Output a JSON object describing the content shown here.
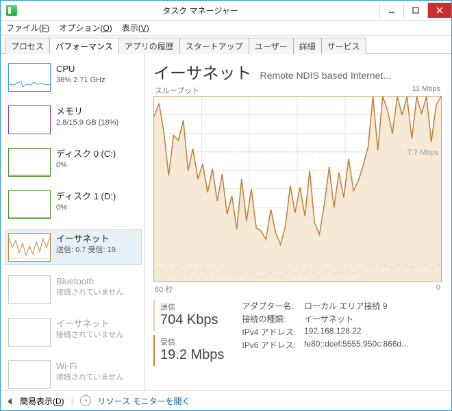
{
  "window": {
    "title": "タスク マネージャー"
  },
  "menu": {
    "file": "ファイル(F)",
    "options": "オプション(O)",
    "view": "表示(V)"
  },
  "tabs": [
    {
      "label": "プロセス"
    },
    {
      "label": "パフォーマンス"
    },
    {
      "label": "アプリの履歴"
    },
    {
      "label": "スタートアップ"
    },
    {
      "label": "ユーザー"
    },
    {
      "label": "詳細"
    },
    {
      "label": "サービス"
    }
  ],
  "sidebar": {
    "items": [
      {
        "title": "CPU",
        "sub": "38% 2.71 GHz",
        "color": "#3b9dd3"
      },
      {
        "title": "メモリ",
        "sub": "2.8/15.9 GB (18%)",
        "color": "#8a2fa2"
      },
      {
        "title": "ディスク 0 (C:)",
        "sub": "0%",
        "color": "#4a8b2a"
      },
      {
        "title": "ディスク 1 (D:)",
        "sub": "0%",
        "color": "#4a8b2a"
      },
      {
        "title": "イーサネット",
        "sub": "送信: 0.7 受信: 19.",
        "color": "#c08238"
      },
      {
        "title": "Bluetooth",
        "sub": "接続されていません",
        "color": "#c7c7c7"
      },
      {
        "title": "イーサネット",
        "sub": "接続されていません",
        "color": "#c7c7c7"
      },
      {
        "title": "Wi-Fi",
        "sub": "接続されていません",
        "color": "#c7c7c7"
      }
    ]
  },
  "panel": {
    "title": "イーサネット",
    "subtitle": "Remote NDIS based Internet...",
    "chart": {
      "throughput_label": "スループット",
      "max_label": "11 Mbps",
      "ref_label": "7.7 Mbps",
      "x_left": "60 秒",
      "x_right": "0"
    },
    "send": {
      "label": "送信",
      "value": "704 Kbps",
      "color": "#e9cfa6"
    },
    "recv": {
      "label": "受信",
      "value": "19.2 Mbps",
      "color": "#c08238"
    },
    "details": {
      "adapter_name_k": "アダプター名:",
      "adapter_name_v": "ローカル エリア接続 9",
      "conn_type_k": "接続の種類:",
      "conn_type_v": "イーサネット",
      "ipv4_k": "IPv4 アドレス:",
      "ipv4_v": "192.168.128.22",
      "ipv6_k": "IPv6 アドレス:",
      "ipv6_v": "fe80::dcef:5555:950c:866d..."
    }
  },
  "statusbar": {
    "simple": "簡易表示(D)",
    "resmon": "リソース モニターを開く"
  },
  "chart_data": {
    "type": "line",
    "title": "イーサネット スループット",
    "xlabel": "秒",
    "ylabel": "Mbps",
    "x_range": [
      60,
      0
    ],
    "ylim": [
      0,
      11
    ],
    "reference_lines": [
      7.7
    ],
    "series": [
      {
        "name": "受信",
        "color": "#c08238",
        "unit": "Mbps",
        "values": [
          9.8,
          10.6,
          8.9,
          6.3,
          8.7,
          8.4,
          9.6,
          6.6,
          7.9,
          6.1,
          7.0,
          5.3,
          6.7,
          4.8,
          6.4,
          4.0,
          5.1,
          3.1,
          6.1,
          3.6,
          5.5,
          3.2,
          3.0,
          2.5,
          4.3,
          2.9,
          2.2,
          3.3,
          5.7,
          4.1,
          5.6,
          3.9,
          6.6,
          3.5,
          2.8,
          4.6,
          6.8,
          4.4,
          6.5,
          5.0,
          7.3,
          5.4,
          6.0,
          6.9,
          8.0,
          11.0,
          7.8,
          11.0,
          10.2,
          8.8,
          11.0,
          9.9,
          11.0,
          8.5,
          11.0,
          10.0,
          11.0,
          8.3,
          10.5,
          11.0
        ]
      },
      {
        "name": "送信",
        "color": "#e9cfa6",
        "unit": "Mbps",
        "values": [
          0.6,
          0.8,
          0.5,
          0.7,
          0.5,
          0.9,
          0.6,
          0.4,
          0.7,
          0.5,
          0.8,
          0.5,
          0.7,
          0.4,
          0.6,
          0.4,
          0.5,
          0.3,
          0.6,
          0.4,
          0.5,
          0.3,
          0.3,
          0.3,
          0.5,
          0.3,
          0.3,
          0.4,
          0.6,
          0.4,
          0.6,
          0.4,
          0.7,
          0.4,
          0.3,
          0.5,
          0.7,
          0.4,
          0.6,
          0.5,
          0.7,
          0.5,
          0.6,
          0.7,
          0.8,
          1.0,
          0.8,
          1.0,
          0.9,
          0.8,
          1.0,
          0.9,
          1.0,
          0.8,
          1.0,
          0.9,
          1.0,
          0.8,
          0.9,
          1.0
        ]
      }
    ]
  }
}
